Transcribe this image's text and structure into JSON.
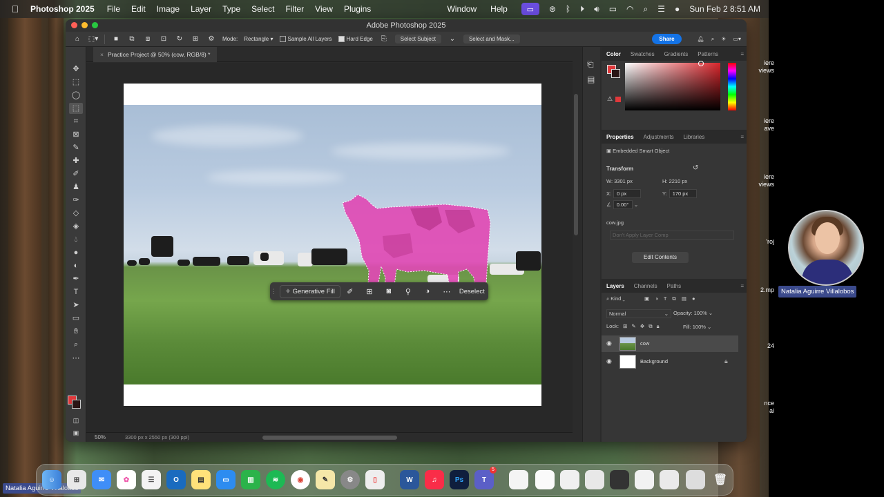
{
  "menubar": {
    "app_name": "Photoshop 2025",
    "items": [
      "File",
      "Edit",
      "Image",
      "Layer",
      "Type",
      "Select",
      "Filter",
      "View",
      "Plugins"
    ],
    "right_items": [
      "Window",
      "Help"
    ],
    "datetime": "Sun Feb 2  8:51 AM"
  },
  "window": {
    "title": "Adobe Photoshop 2025"
  },
  "options_bar": {
    "mode_label": "Mode:",
    "mode_value": "Rectangle",
    "sample_all_layers": "Sample All Layers",
    "hard_edge": "Hard Edge",
    "select_subject": "Select Subject",
    "select_and_mask": "Select and Mask...",
    "share": "Share"
  },
  "document": {
    "tab_title": "Practice Project @ 50% (cow, RGB/8) *",
    "zoom": "50%",
    "dimensions": "3300 px x 2550 px (300 ppi)"
  },
  "context_bar": {
    "generative_fill": "Generative Fill",
    "deselect": "Deselect"
  },
  "color_panel": {
    "tabs": [
      "Color",
      "Swatches",
      "Gradients",
      "Patterns"
    ],
    "fg_color": "#e0383b",
    "bg_color": "#2a1515"
  },
  "properties_panel": {
    "tabs": [
      "Properties",
      "Adjustments",
      "Libraries"
    ],
    "object_type": "Embedded Smart Object",
    "transform_label": "Transform",
    "w_label": "W:",
    "w_value": "3301 px",
    "h_label": "H:",
    "h_value": "2210 px",
    "x_label": "X:",
    "x_value": "0 px",
    "y_label": "Y:",
    "y_value": "170 px",
    "angle_value": "0.00°",
    "filename": "cow.jpg",
    "layer_comp": "Don't Apply Layer Comp",
    "edit_contents": "Edit Contents"
  },
  "layers_panel": {
    "tabs": [
      "Layers",
      "Channels",
      "Paths"
    ],
    "kind_label": "Kind",
    "blend_mode": "Normal",
    "opacity_label": "Opacity:",
    "opacity_value": "100%",
    "lock_label": "Lock:",
    "fill_label": "Fill:",
    "fill_value": "100%",
    "layers": [
      {
        "name": "cow",
        "selected": true
      },
      {
        "name": "Background",
        "selected": false
      }
    ]
  },
  "video": {
    "participant_name": "Natalia Aguirre Villalobos",
    "partial_texts": [
      "iere\nviews",
      "iere\nave",
      "iere\nviews",
      "'roj",
      "2.mp",
      "24",
      "nce\nai"
    ]
  },
  "dock": {
    "teams_badge": "5"
  }
}
